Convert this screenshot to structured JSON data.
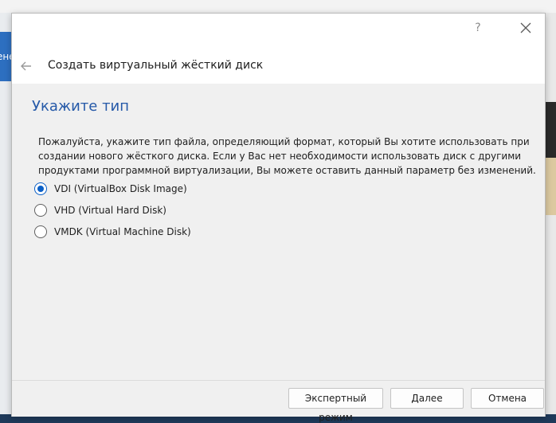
{
  "background": {
    "left_fragment_text": "ене"
  },
  "titlebar": {
    "help_label": "?"
  },
  "wizard": {
    "title": "Создать виртуальный жёсткий диск",
    "page_title": "Укажите тип",
    "description": "Пожалуйста, укажите тип файла, определяющий формат, который Вы хотите использовать при создании нового жёсткого диска. Если у Вас нет необходимости использовать диск с другими продуктами программной виртуализации, Вы можете оставить данный параметр без изменений.",
    "options": [
      {
        "label": "VDI (VirtualBox Disk Image)",
        "checked": true
      },
      {
        "label": "VHD (Virtual Hard Disk)",
        "checked": false
      },
      {
        "label": "VMDK (Virtual Machine Disk)",
        "checked": false
      }
    ]
  },
  "footer": {
    "expert_label": "Экспертный режим",
    "next_label": "Далее",
    "cancel_label": "Отмена"
  },
  "colors": {
    "accent": "#0a5fc7",
    "title_blue": "#2559a8"
  }
}
